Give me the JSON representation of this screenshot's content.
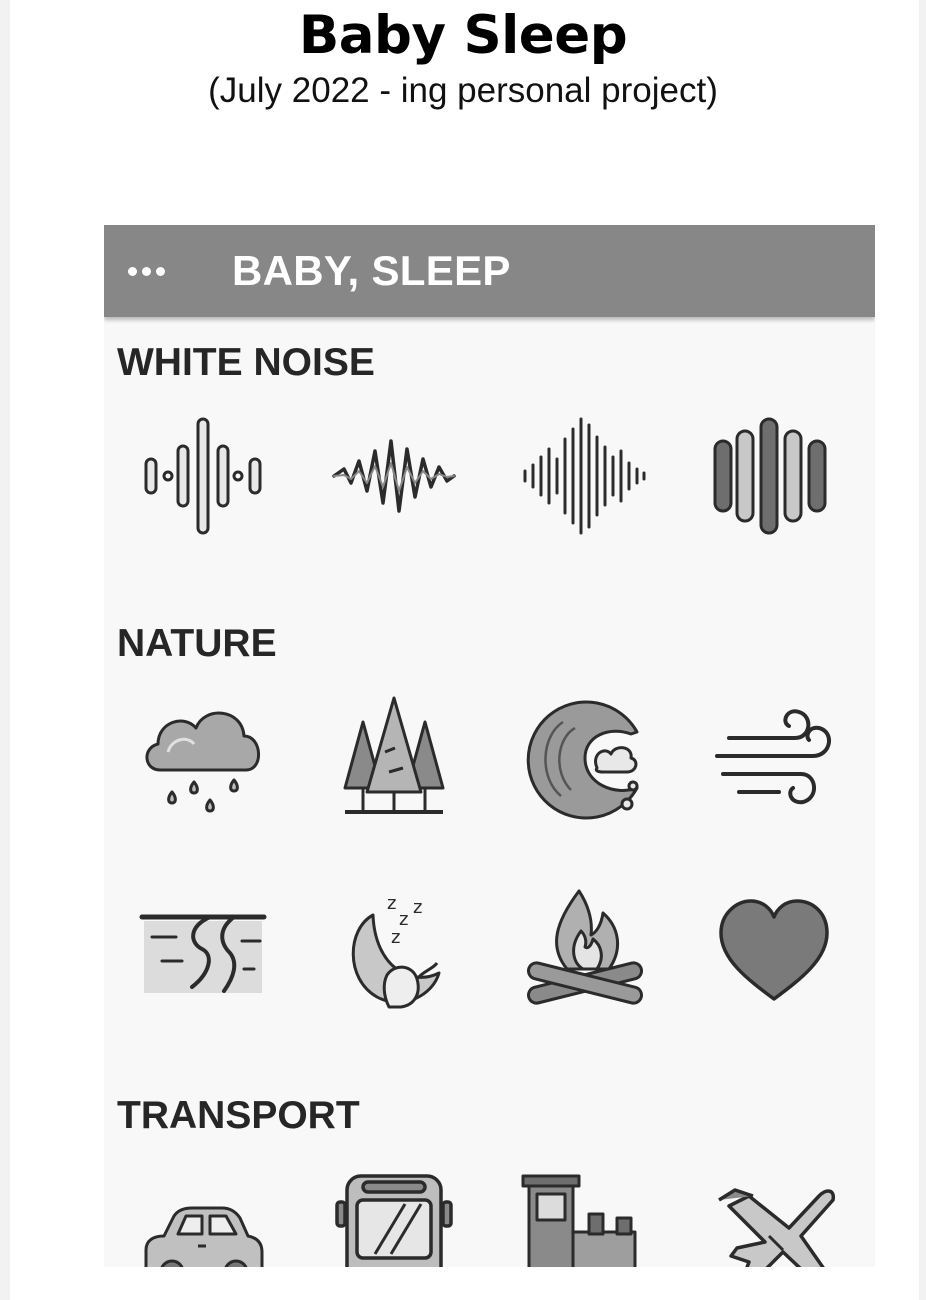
{
  "header": {
    "title": "Baby Sleep",
    "subtitle": "(July 2022 - ing personal project)"
  },
  "app": {
    "title": "BABY, SLEEP",
    "menu_icon": "more-dots-icon",
    "colors": {
      "appbar": "#878787",
      "background": "#f8f8f8",
      "icon_stroke": "#2b2b2b",
      "icon_fill_light": "#c8c8c8",
      "icon_fill_dark": "#6e6e6e"
    },
    "sections": [
      {
        "title": "WHITE NOISE",
        "items": [
          "sound-wave-1-icon",
          "sound-wave-2-icon",
          "sound-wave-3-icon",
          "sound-wave-4-icon"
        ]
      },
      {
        "title": "NATURE",
        "items": [
          "rain-cloud-icon",
          "forest-icon",
          "ocean-wave-icon",
          "wind-icon",
          "river-icon",
          "moon-sleep-icon",
          "campfire-icon",
          "heartbeat-icon"
        ]
      },
      {
        "title": "TRANSPORT",
        "items": [
          "car-icon",
          "bus-icon",
          "train-icon",
          "airplane-icon"
        ]
      }
    ]
  }
}
